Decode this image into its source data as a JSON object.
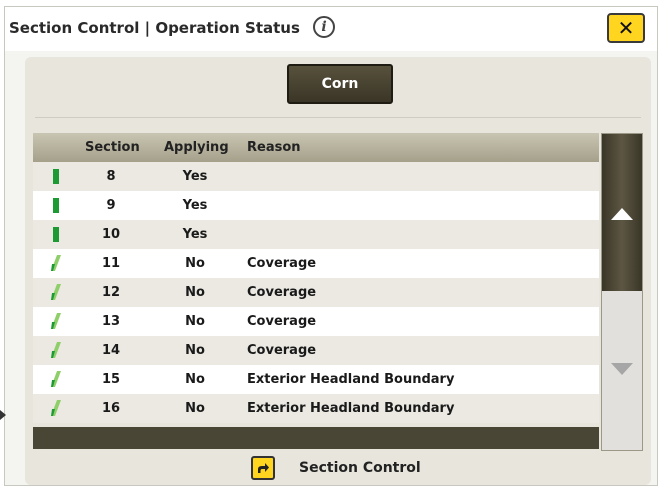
{
  "window": {
    "title": "Section Control | Operation Status",
    "info_symbol": "i",
    "close_symbol": "✕",
    "icons": {
      "info": "info-icon",
      "close": "close-icon"
    }
  },
  "crop_button": {
    "label": "Corn"
  },
  "table": {
    "headers": {
      "section": "Section",
      "applying": "Applying",
      "reason": "Reason"
    },
    "rows": [
      {
        "status_icon": "section-on-icon",
        "section": "8",
        "applying": "Yes",
        "reason": ""
      },
      {
        "status_icon": "section-on-icon",
        "section": "9",
        "applying": "Yes",
        "reason": ""
      },
      {
        "status_icon": "section-on-icon",
        "section": "10",
        "applying": "Yes",
        "reason": ""
      },
      {
        "status_icon": "section-off-icon",
        "section": "11",
        "applying": "No",
        "reason": "Coverage"
      },
      {
        "status_icon": "section-off-icon",
        "section": "12",
        "applying": "No",
        "reason": "Coverage"
      },
      {
        "status_icon": "section-off-icon",
        "section": "13",
        "applying": "No",
        "reason": "Coverage"
      },
      {
        "status_icon": "section-off-icon",
        "section": "14",
        "applying": "No",
        "reason": "Coverage"
      },
      {
        "status_icon": "section-off-icon",
        "section": "15",
        "applying": "No",
        "reason": "Exterior Headland Boundary"
      },
      {
        "status_icon": "section-off-icon",
        "section": "16",
        "applying": "No",
        "reason": "Exterior Headland Boundary"
      }
    ]
  },
  "scrollbar": {
    "up_icon": "arrow-up-icon",
    "down_icon": "arrow-down-icon"
  },
  "footer_link": {
    "label": "Section Control",
    "icon": "navigate-arrow-icon"
  },
  "colors": {
    "accent_yellow": "#ffd520",
    "section_on": "#1e9a35",
    "section_off": "#8fcf6a",
    "dark_olive": "#3a3526",
    "header_tan": "#b9b5a0"
  }
}
